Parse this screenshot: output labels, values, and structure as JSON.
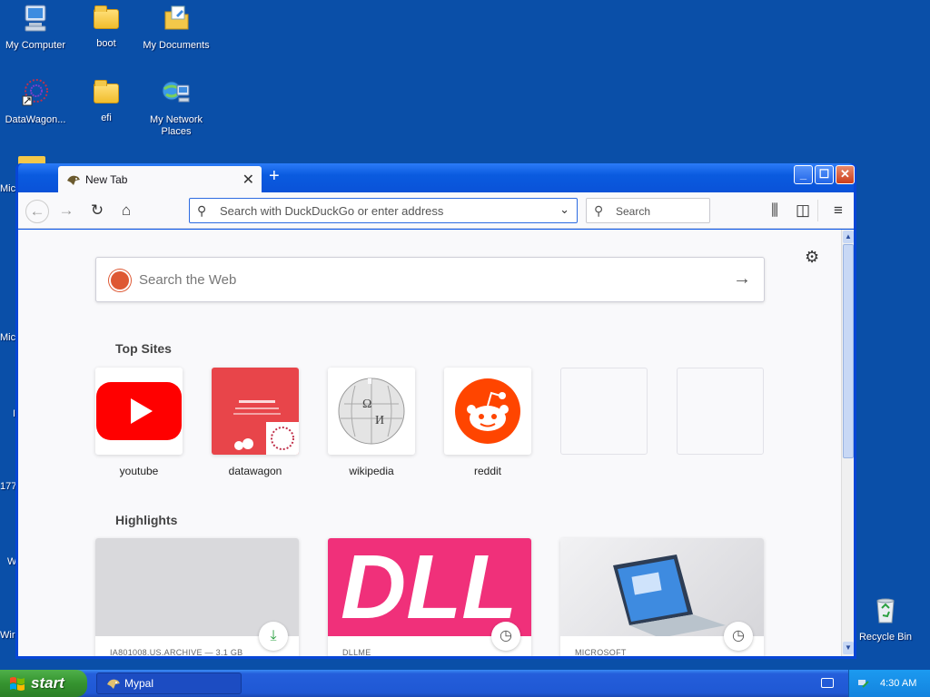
{
  "desktop": {
    "icons": [
      {
        "label": "My Computer"
      },
      {
        "label": "boot"
      },
      {
        "label": "My Documents"
      },
      {
        "label": "DataWagon..."
      },
      {
        "label": "efi"
      },
      {
        "label": "My Network Places"
      },
      {
        "label": "Recycle Bin"
      }
    ],
    "partial_labels": [
      "Mic",
      "Mic",
      "I",
      "177",
      "W",
      "Wir"
    ]
  },
  "browser": {
    "tab": {
      "title": "New Tab"
    },
    "urlbar": {
      "placeholder": "Search with DuckDuckGo or enter address"
    },
    "searchbar": {
      "placeholder": "Search"
    },
    "newtab_page": {
      "web_search_placeholder": "Search the Web",
      "top_sites_title": "Top Sites",
      "top_sites": [
        {
          "name": "youtube",
          "icon": "youtube-icon",
          "color": "#ff0000"
        },
        {
          "name": "datawagon",
          "icon": "datawagon-thumbnail",
          "color": "#e8454a"
        },
        {
          "name": "wikipedia",
          "icon": "wikipedia-globe-icon",
          "color": "#999999"
        },
        {
          "name": "reddit",
          "icon": "reddit-icon",
          "color": "#ff4500"
        },
        {
          "name": "",
          "icon": "empty"
        },
        {
          "name": "",
          "icon": "empty"
        }
      ],
      "highlights_title": "Highlights",
      "highlights": [
        {
          "source": "IA801008.US.ARCHIVE — 3.1 GB",
          "badge_icon": "download-icon",
          "image_color": "#d9d9dc"
        },
        {
          "source": "DLLME",
          "badge_icon": "clock-icon",
          "image_text": "DLL",
          "image_color": "#f0307a"
        },
        {
          "source": "MICROSOFT",
          "badge_icon": "clock-icon",
          "image_color": "#e8e8ea"
        }
      ]
    }
  },
  "taskbar": {
    "start_label": "start",
    "task_button": "Mypal",
    "clock": "4:30 AM"
  },
  "colors": {
    "desktop_bg": "#0a4fa8",
    "accent": "#2d6be1",
    "youtube_red": "#ff0000",
    "reddit_orange": "#ff4500"
  }
}
